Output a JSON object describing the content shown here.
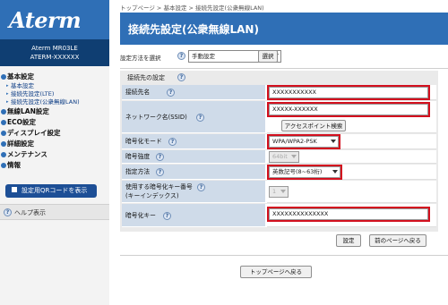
{
  "sidebar": {
    "logo": "Aterm",
    "model": "Aterm  MR03LE",
    "device_id": "ATERM-XXXXXX",
    "menu": [
      {
        "label": "基本設定",
        "children": [
          "基本設定",
          "接続先設定(LTE)",
          "接続先設定(公衆無線LAN)"
        ]
      },
      {
        "label": "無線LAN設定"
      },
      {
        "label": "ECO設定"
      },
      {
        "label": "ディスプレイ設定"
      },
      {
        "label": "詳細設定"
      },
      {
        "label": "メンテナンス"
      },
      {
        "label": "情報"
      }
    ],
    "qr_button": "設定用QRコードを表示",
    "help_label": "ヘルプ表示"
  },
  "header": {
    "breadcrumb": "トップページ > 基本設定 > 接続先設定(公衆無線LAN)",
    "title": "接続先設定(公衆無線LAN)"
  },
  "method": {
    "label": "設定方法を選択",
    "selected": "手動設定",
    "button": "選択"
  },
  "section": {
    "title": "接続先の設定",
    "rows": {
      "name": {
        "label": "接続先名",
        "value": "XXXXXXXXXXX"
      },
      "ssid": {
        "label": "ネットワーク名(SSID)",
        "value": "XXXXX-XXXXXX",
        "button": "アクセスポイント検索"
      },
      "enc_mode": {
        "label": "暗号化モード",
        "value": "WPA/WPA2-PSK"
      },
      "enc_strength": {
        "label": "暗号強度",
        "value": "64bit"
      },
      "spec": {
        "label": "指定方法",
        "value": "英数記号(8~63桁)"
      },
      "key_index": {
        "label": "使用する暗号化キー番号",
        "label2": "(キーインデックス)",
        "value": "1"
      },
      "enc_key": {
        "label": "暗号化キー",
        "value": "XXXXXXXXXXXXXX"
      }
    }
  },
  "actions": {
    "set": "設定",
    "back": "前のページへ戻る",
    "top": "トップページへ戻る"
  },
  "colors": {
    "brand_blue": "#2f6fb6",
    "dark_blue": "#0f3e72",
    "label_bg": "#cfdbe9",
    "highlight": "#d3101e"
  }
}
